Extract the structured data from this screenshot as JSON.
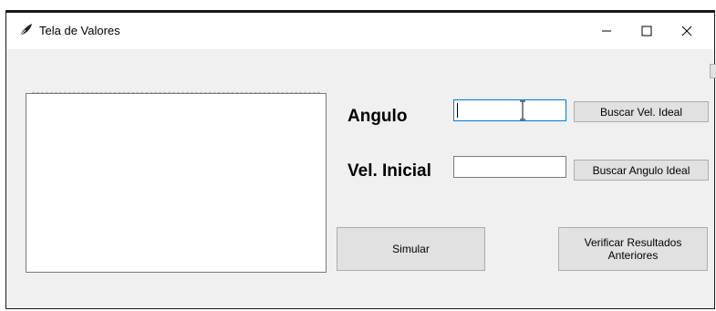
{
  "window": {
    "title": "Tela de Valores"
  },
  "form": {
    "angle_label": "Angulo",
    "angle_value": "",
    "initial_velocity_label": "Vel. Inicial",
    "initial_velocity_value": "",
    "search_ideal_velocity_button": "Buscar Vel. Ideal",
    "search_ideal_angle_button": "Buscar Angulo Ideal",
    "simulate_button": "Simular",
    "verify_results_button_line1": "Verificar Resultados",
    "verify_results_button_line2": "Anteriores"
  },
  "colors": {
    "focus_border": "#0078d7",
    "button_face": "#e1e1e1",
    "window_background": "#f0f0f0"
  }
}
